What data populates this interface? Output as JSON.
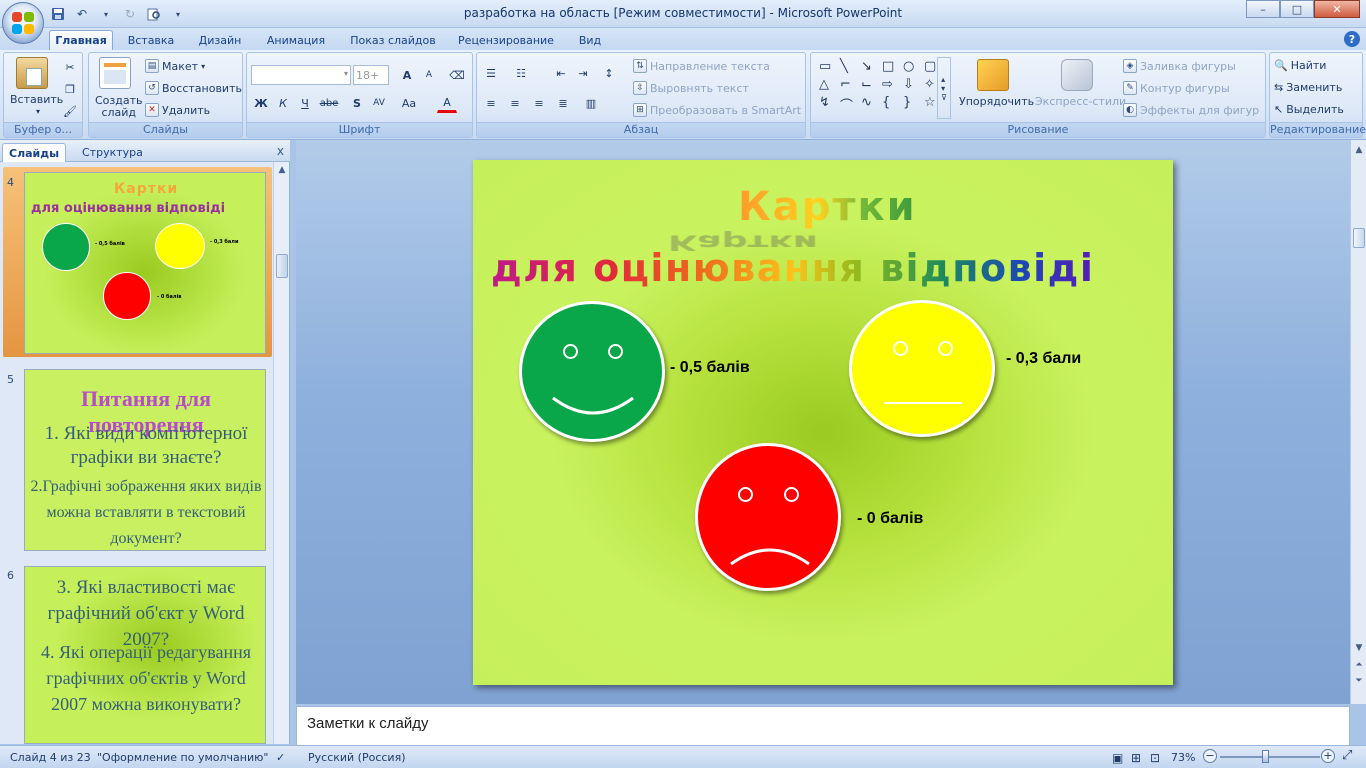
{
  "window": {
    "title": "разработка на область [Режим совместимости] - Microsoft PowerPoint",
    "controls": {
      "minimize": "–",
      "maximize": "□",
      "close": "✕"
    }
  },
  "ribbon_tabs": [
    "Главная",
    "Вставка",
    "Дизайн",
    "Анимация",
    "Показ слайдов",
    "Рецензирование",
    "Вид"
  ],
  "ribbon": {
    "clipboard": {
      "paste": "Вставить",
      "label": "Буфер о..."
    },
    "slides": {
      "new_slide": "Создать слайд",
      "layout": "Макет",
      "reset": "Восстановить",
      "delete": "Удалить",
      "label": "Слайды"
    },
    "font": {
      "size": "18+",
      "label": "Шрифт",
      "bold": "Ж",
      "italic": "К",
      "underline": "Ч",
      "strike": "abe",
      "shadow": "S",
      "spacing": "AV",
      "case": "Aa",
      "grow": "A",
      "shrink": "A",
      "color": "A"
    },
    "paragraph": {
      "text_direction": "Направление текста",
      "align_text": "Выровнять текст",
      "smartart": "Преобразовать в SmartArt",
      "label": "Абзац"
    },
    "drawing": {
      "arrange": "Упорядочить",
      "quick_styles": "Экспресс-стили",
      "fill": "Заливка фигуры",
      "outline": "Контур фигуры",
      "effects": "Эффекты для фигур",
      "label": "Рисование"
    },
    "editing": {
      "find": "Найти",
      "replace": "Заменить",
      "select": "Выделить",
      "label": "Редактирование"
    }
  },
  "left_pane": {
    "tabs": [
      "Слайды",
      "Структура"
    ],
    "close": "x",
    "thumbnails": [
      {
        "number": "4",
        "title1": "Картки",
        "title2": "для оцінювання відповіді",
        "labels": [
          "- 0,5 балів",
          "- 0,3 бали",
          "- 0 балів"
        ]
      },
      {
        "number": "5",
        "title": "Питання для повторення",
        "lines": [
          "1. Які види комп'ютерної графіки ви знаєте?",
          "2.Графічні зображення яких видів можна вставляти в текстовий документ?"
        ]
      },
      {
        "number": "6",
        "lines": [
          "3. Які властивості має графічний об'єкт у Word 2007?",
          "4. Які операції редагування графічних об'єктів у Word 2007 можна виконувати?"
        ]
      }
    ]
  },
  "slide": {
    "title1": "Картки",
    "title2": "для оцінювання відповіді",
    "faces": [
      {
        "mood": "happy",
        "color": "#0aa64a",
        "label": "- 0,5 балів"
      },
      {
        "mood": "neutral",
        "color": "#ffff00",
        "label": "- 0,3 бали"
      },
      {
        "mood": "sad",
        "color": "#ff0000",
        "label": "- 0 балів"
      }
    ],
    "background_color": "#c6f05a"
  },
  "notes": {
    "placeholder": "Заметки к слайду"
  },
  "status_bar": {
    "slide_info": "Слайд 4 из 23",
    "theme": "\"Оформление по умолчанию\"",
    "language": "Русский (Россия)",
    "zoom": "73%",
    "zoom_fraction": 0.45
  },
  "colors": {
    "ribbon_bg": "#dde8f7",
    "accent": "#15428b",
    "selected_thumb": "#e8a259"
  }
}
